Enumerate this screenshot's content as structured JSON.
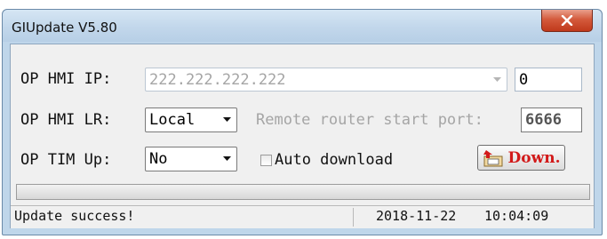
{
  "window": {
    "title": "GIUpdate V5.80"
  },
  "form": {
    "op_hmi_ip_label": "OP HMI IP:",
    "op_hmi_ip_value": "222.222.222.222",
    "op_hmi_ip_index": "0",
    "op_hmi_lr_label": "OP HMI LR:",
    "op_hmi_lr_value": "Local",
    "remote_port_label": "Remote router start port:",
    "remote_port_value": "6666",
    "op_tim_up_label": "OP TIM Up:",
    "op_tim_up_value": "No",
    "auto_download_label": "Auto download",
    "auto_download_checked": false,
    "down_button_label": "Down."
  },
  "progress": {
    "value": 0
  },
  "status": {
    "message": "Update success!",
    "date": "2018-11-22",
    "time": "10:04:09"
  },
  "colors": {
    "down_button_text": "#d21a1a",
    "close_button": "#c0391b"
  }
}
